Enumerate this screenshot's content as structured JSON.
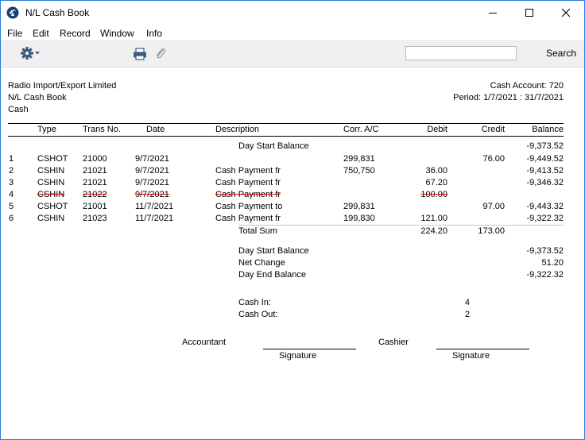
{
  "window": {
    "title": "N/L Cash Book",
    "controls": {
      "minimize": "minimize",
      "maximize": "maximize",
      "close": "close"
    }
  },
  "menu": [
    "File",
    "Edit",
    "Record",
    "Window",
    "Info"
  ],
  "toolbar": {
    "search_value": "",
    "search_button": "Search",
    "icons": [
      "gear-icon",
      "printer-icon",
      "paperclip-icon"
    ]
  },
  "report": {
    "company": "Radio Import/Export Limited",
    "report_name": "N/L Cash Book",
    "account_name": "Cash",
    "account_line": "Cash Account: 720",
    "period_line": "Period: 1/7/2021 : 31/7/2021",
    "columns": [
      "Type",
      "Trans No.",
      "Date",
      "Description",
      "Corr. A/C",
      "Debit",
      "Credit",
      "Balance"
    ],
    "day_start": {
      "label": "Day Start Balance",
      "balance": "-9,373.52"
    },
    "rows": [
      {
        "no": "1",
        "type": "CSHOT",
        "trans": "21000",
        "date": "9/7/2021",
        "desc": "",
        "corr": "299,831",
        "debit": "",
        "credit": "76.00",
        "balance": "-9,449.52",
        "cancelled": false
      },
      {
        "no": "2",
        "type": "CSHIN",
        "trans": "21021",
        "date": "9/7/2021",
        "desc": "Cash Payment fr",
        "corr": "750,750",
        "debit": "36.00",
        "credit": "",
        "balance": "-9,413.52",
        "cancelled": false
      },
      {
        "no": "3",
        "type": "CSHIN",
        "trans": "21021",
        "date": "9/7/2021",
        "desc": "Cash Payment fr",
        "corr": "",
        "debit": "67.20",
        "credit": "",
        "balance": "-9,346.32",
        "cancelled": false
      },
      {
        "no": "4",
        "type": "CSHIN",
        "trans": "21022",
        "date": "9/7/2021",
        "desc": "Cash Payment fr",
        "corr": "",
        "debit": "100.00",
        "credit": "",
        "balance": "",
        "cancelled": true
      },
      {
        "no": "5",
        "type": "CSHOT",
        "trans": "21001",
        "date": "11/7/2021",
        "desc": "Cash Payment to",
        "corr": "299,831",
        "debit": "",
        "credit": "97.00",
        "balance": "-9,443.32",
        "cancelled": false
      },
      {
        "no": "6",
        "type": "CSHIN",
        "trans": "21023",
        "date": "11/7/2021",
        "desc": "Cash Payment fr",
        "corr": "199,830",
        "debit": "121.00",
        "credit": "",
        "balance": "-9,322.32",
        "cancelled": false
      }
    ],
    "total_sum": {
      "label": "Total Sum",
      "debit": "224.20",
      "credit": "173.00"
    },
    "summary": [
      {
        "label": "Day Start Balance",
        "value": "-9,373.52"
      },
      {
        "label": "Net Change",
        "value": "51.20"
      },
      {
        "label": "Day End Balance",
        "value": "-9,322.32"
      }
    ],
    "counts": [
      {
        "label": "Cash In:",
        "value": "4"
      },
      {
        "label": "Cash Out:",
        "value": "2"
      }
    ],
    "signatures": {
      "accountant": "Accountant",
      "cashier": "Cashier",
      "signature_label": "Signature"
    }
  }
}
